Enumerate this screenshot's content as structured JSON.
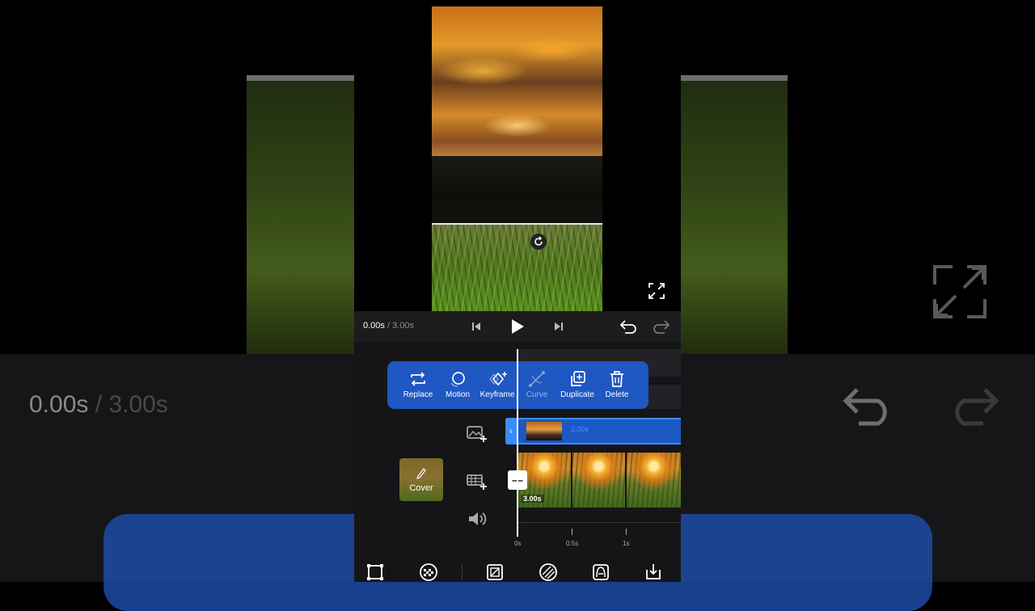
{
  "background": {
    "time_current": "0.00s",
    "time_total": " / 3.00s"
  },
  "playback": {
    "time_current": "0.00s",
    "time_total": " / 3.00s"
  },
  "context_menu": {
    "items": [
      {
        "label": "Replace",
        "icon": "replace-icon",
        "enabled": true
      },
      {
        "label": "Motion",
        "icon": "motion-icon",
        "enabled": true
      },
      {
        "label": "Keyframe",
        "icon": "keyframe-icon",
        "enabled": true
      },
      {
        "label": "Curve",
        "icon": "curve-icon",
        "enabled": false
      },
      {
        "label": "Duplicate",
        "icon": "duplicate-icon",
        "enabled": true
      },
      {
        "label": "Delete",
        "icon": "delete-icon",
        "enabled": true
      }
    ]
  },
  "overlay_track": {
    "duration": "3.00s"
  },
  "main_track": {
    "duration": "3.00s",
    "cover_label": "Cover"
  },
  "ruler": {
    "labels": [
      "0s",
      "0.5s",
      "1s"
    ]
  },
  "colors": {
    "accent_blue": "#1f57c3",
    "selected_border": "#3a8cff",
    "panel_bg": "#151517"
  }
}
